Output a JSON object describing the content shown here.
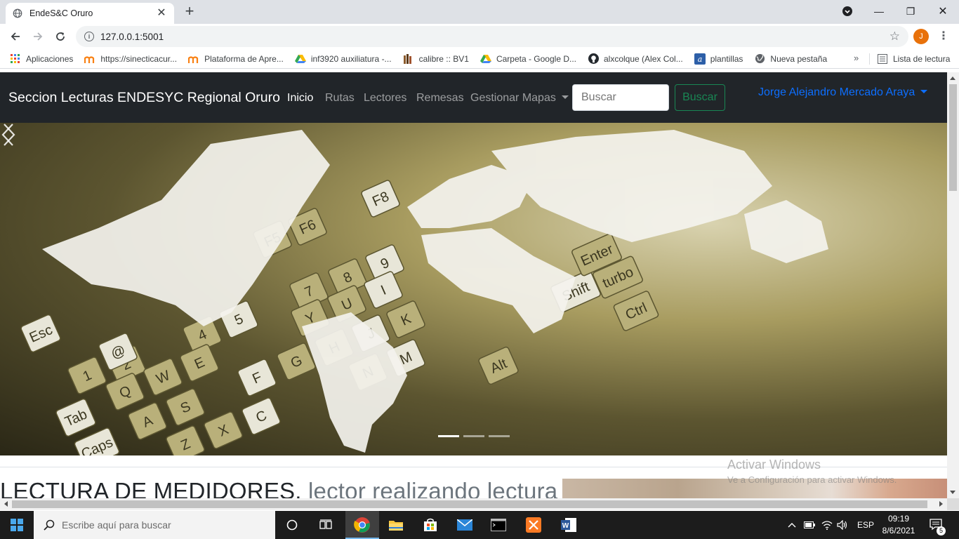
{
  "browser": {
    "tab_title": "EndeS&C Oruro",
    "tab_close": "✕",
    "new_tab": "+",
    "url": "127.0.0.1:5001",
    "profile_initial": "J",
    "window_controls": {
      "minimize": "—",
      "restore": "❐",
      "close": "✕"
    }
  },
  "bookmarks": {
    "items": [
      {
        "label": "Aplicaciones",
        "icon": "apps-grid-icon"
      },
      {
        "label": "https://sinecticacur...",
        "icon": "moodle-icon"
      },
      {
        "label": "Plataforma de Apre...",
        "icon": "moodle-icon"
      },
      {
        "label": "inf3920 auxiliatura -...",
        "icon": "google-drive-icon"
      },
      {
        "label": "calibre :: BV1",
        "icon": "calibre-books-icon"
      },
      {
        "label": "Carpeta - Google D...",
        "icon": "google-drive-icon"
      },
      {
        "label": "alxcolque (Alex Col...",
        "icon": "github-icon"
      },
      {
        "label": "plantillas",
        "icon": "a-letter-icon"
      },
      {
        "label": "Nueva pestaña",
        "icon": "globe-icon"
      }
    ],
    "more": "»",
    "reading_list": "Lista de lectura"
  },
  "navbar": {
    "brand": "Seccion Lecturas ENDESYC Regional Oruro",
    "links": [
      "Inicio",
      "Rutas",
      "Lectores",
      "Remesas",
      "Gestionar Mapas"
    ],
    "search_placeholder": "Buscar",
    "search_button": "Buscar",
    "user": "Jorge Alejandro Mercado Araya"
  },
  "carousel": {
    "slide_count": 3,
    "active_slide": 1,
    "keys": [
      "Esc",
      "1",
      "2",
      "@",
      "Q",
      "W",
      "Tab",
      "A",
      "S",
      "Caps",
      "Z",
      "X",
      "C",
      "Shift",
      "Alt",
      "Ctrl",
      "F5",
      "F6",
      "F8",
      "7",
      "8",
      "9",
      "Y",
      "U",
      "I",
      "G",
      "H",
      "J",
      "K",
      "N",
      "M",
      "Alt",
      "Ctrl",
      "Shift",
      "Enter",
      "turbo",
      "5",
      "4",
      "E",
      "F"
    ]
  },
  "content": {
    "heading_main": "LECTURA DE MEDIDORES.",
    "heading_muted": "lector realizando lectura"
  },
  "watermark": {
    "line1": "Activar Windows",
    "line2": "Ve a Configuración para activar Windows."
  },
  "taskbar": {
    "search_placeholder": "Escribe aquí para buscar",
    "language": "ESP",
    "time": "09:19",
    "date": "8/6/2021",
    "notifications": "5"
  },
  "colors": {
    "navbar_bg": "#212529",
    "link_active": "#ffffff",
    "user_link": "#0d6efd",
    "success": "#198754"
  }
}
